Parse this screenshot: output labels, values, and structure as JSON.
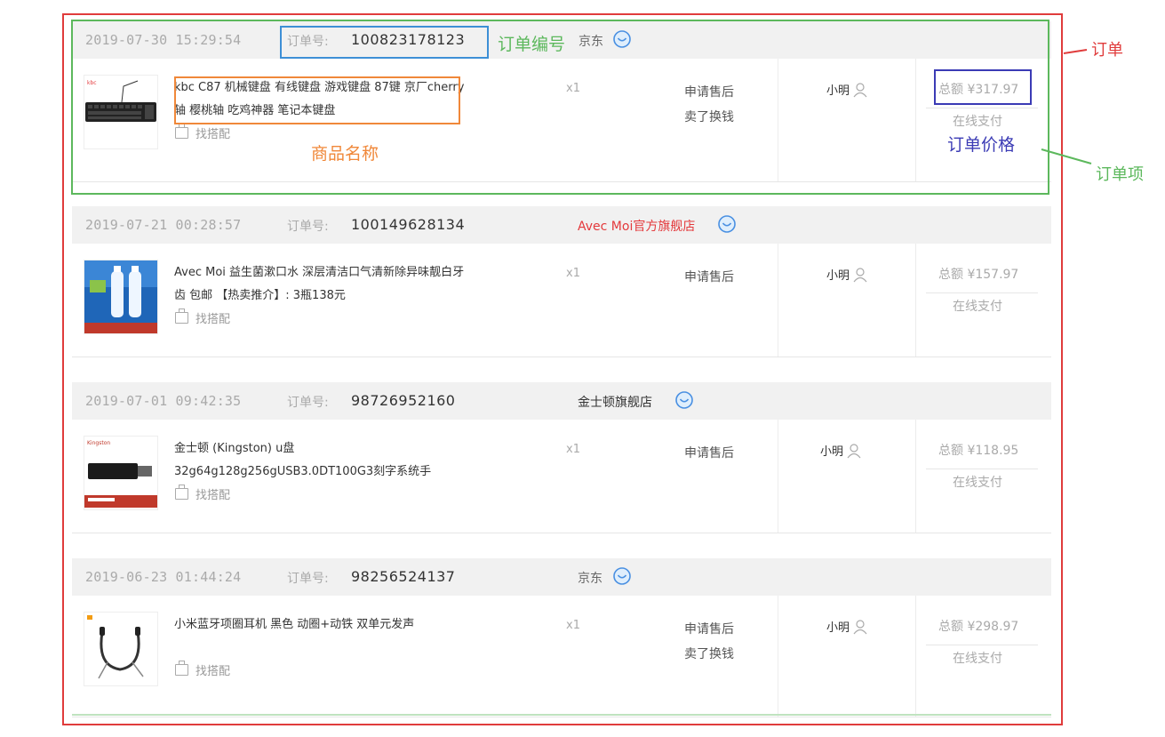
{
  "orders": [
    {
      "date": "2019-07-30 15:29:54",
      "order_no_label": "订单号:",
      "order_no": "100823178123",
      "shop": "京东",
      "product": "kbc C87 机械键盘 有线键盘 游戏键盘 87键 京厂cherry轴 樱桃轴 吃鸡神器 笔记本键盘",
      "find_match": "找搭配",
      "qty": "x1",
      "after_sale": "申请售后",
      "resell": "卖了换钱",
      "user": "小明",
      "total": "总额 ¥317.97",
      "pay": "在线支付"
    },
    {
      "date": "2019-07-21 00:28:57",
      "order_no_label": "订单号:",
      "order_no": "100149628134",
      "shop": "Avec Moi官方旗舰店",
      "product": "Avec Moi 益生菌漱口水 深层清洁口气清新除异味靓白牙齿 包邮 【热卖推介】: 3瓶138元",
      "find_match": "找搭配",
      "qty": "x1",
      "after_sale": "申请售后",
      "resell": "",
      "user": "小明",
      "total": "总额 ¥157.97",
      "pay": "在线支付"
    },
    {
      "date": "2019-07-01 09:42:35",
      "order_no_label": "订单号:",
      "order_no": "98726952160",
      "shop": "金士顿旗舰店",
      "product": "金士顿 (Kingston) u盘 32g64g128g256gUSB3.0DT100G3刻字系统手",
      "find_match": "找搭配",
      "qty": "x1",
      "after_sale": "申请售后",
      "resell": "",
      "user": "小明",
      "total": "总额 ¥118.95",
      "pay": "在线支付"
    },
    {
      "date": "2019-06-23 01:44:24",
      "order_no_label": "订单号:",
      "order_no": "98256524137",
      "shop": "京东",
      "product": "小米蓝牙项圈耳机 黑色 动圈+动铁 双单元发声",
      "find_match": "找搭配",
      "qty": "x1",
      "after_sale": "申请售后",
      "resell": "卖了换钱",
      "user": "小明",
      "total": "总额 ¥298.97",
      "pay": "在线支付"
    }
  ],
  "annotations": {
    "order": "订单",
    "order_item": "订单项",
    "order_number": "订单编号",
    "product_name": "商品名称",
    "order_price": "订单价格"
  },
  "colors": {
    "order_box": "#e03c3c",
    "order_item_box": "#5cb85c",
    "order_number_box": "#3d8fd6",
    "product_name_box": "#f0883a",
    "order_price_box": "#3b3bb5",
    "shop_red": "#e4393c"
  }
}
